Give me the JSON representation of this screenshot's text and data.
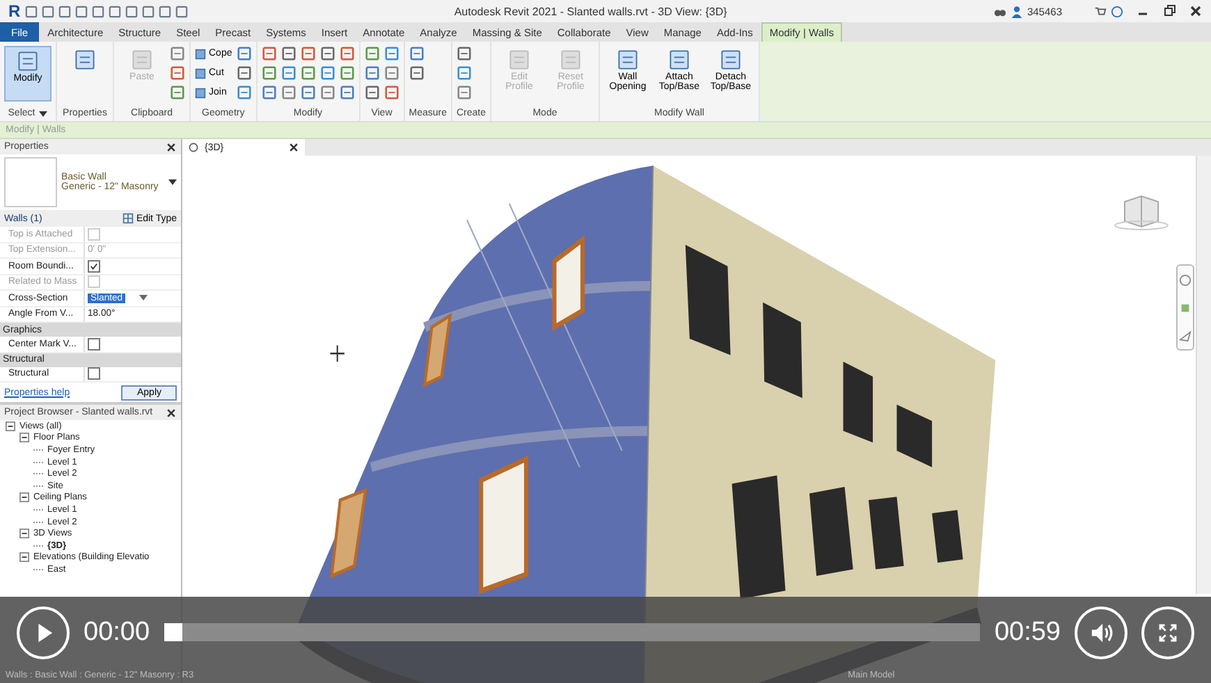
{
  "window": {
    "logo": "R",
    "title": "Autodesk Revit 2021 - Slanted walls.rvt - 3D View: {3D}",
    "user": "345463"
  },
  "ribbon_tabs": [
    {
      "label": "File",
      "kind": "file",
      "selected": false
    },
    {
      "label": "Architecture",
      "kind": "tab",
      "selected": false
    },
    {
      "label": "Structure",
      "kind": "tab",
      "selected": false
    },
    {
      "label": "Steel",
      "kind": "tab",
      "selected": false
    },
    {
      "label": "Precast",
      "kind": "tab",
      "selected": false
    },
    {
      "label": "Systems",
      "kind": "tab",
      "selected": false
    },
    {
      "label": "Insert",
      "kind": "tab",
      "selected": false
    },
    {
      "label": "Annotate",
      "kind": "tab",
      "selected": false
    },
    {
      "label": "Analyze",
      "kind": "tab",
      "selected": false
    },
    {
      "label": "Massing & Site",
      "kind": "tab",
      "selected": false
    },
    {
      "label": "Collaborate",
      "kind": "tab",
      "selected": false
    },
    {
      "label": "View",
      "kind": "tab",
      "selected": false
    },
    {
      "label": "Manage",
      "kind": "tab",
      "selected": false
    },
    {
      "label": "Add-Ins",
      "kind": "tab",
      "selected": false
    },
    {
      "label": "Modify | Walls",
      "kind": "context",
      "selected": true
    }
  ],
  "ribbon_panels": [
    {
      "label": "Select",
      "menu": true,
      "tools": [
        {
          "kind": "large",
          "label": "Modify",
          "disabled": false,
          "selected": true
        }
      ]
    },
    {
      "label": "Properties",
      "menu": false,
      "tools": [
        {
          "kind": "large",
          "disabled": false,
          "selected": false
        }
      ]
    },
    {
      "label": "Clipboard",
      "menu": false,
      "tools": [
        {
          "kind": "large",
          "label": "Paste",
          "disabled": true,
          "selected": false
        },
        {
          "kind": "icon"
        },
        {
          "kind": "icon"
        },
        {
          "kind": "icon"
        }
      ]
    },
    {
      "label": "Geometry",
      "menu": false,
      "tools": [
        {
          "kind": "small",
          "label": "Cope"
        },
        {
          "kind": "small",
          "label": "Cut"
        },
        {
          "kind": "small",
          "label": "Join"
        },
        {
          "kind": "icon"
        },
        {
          "kind": "icon"
        },
        {
          "kind": "icon"
        }
      ]
    },
    {
      "label": "Modify",
      "menu": false,
      "tools": [
        {
          "kind": "icon"
        },
        {
          "kind": "icon"
        },
        {
          "kind": "icon"
        },
        {
          "kind": "icon"
        },
        {
          "kind": "icon"
        },
        {
          "kind": "icon"
        },
        {
          "kind": "icon"
        },
        {
          "kind": "icon"
        },
        {
          "kind": "icon"
        },
        {
          "kind": "icon"
        },
        {
          "kind": "icon"
        },
        {
          "kind": "icon"
        },
        {
          "kind": "icon"
        },
        {
          "kind": "icon"
        },
        {
          "kind": "icon"
        }
      ]
    },
    {
      "label": "View",
      "menu": false,
      "tools": [
        {
          "kind": "icon"
        },
        {
          "kind": "icon"
        },
        {
          "kind": "icon"
        },
        {
          "kind": "icon"
        },
        {
          "kind": "icon"
        },
        {
          "kind": "icon"
        }
      ]
    },
    {
      "label": "Measure",
      "menu": false,
      "tools": [
        {
          "kind": "icon"
        },
        {
          "kind": "icon"
        }
      ]
    },
    {
      "label": "Create",
      "menu": false,
      "tools": [
        {
          "kind": "icon"
        },
        {
          "kind": "icon"
        },
        {
          "kind": "icon"
        }
      ]
    },
    {
      "label": "Mode",
      "menu": false,
      "tools": [
        {
          "kind": "large",
          "label": "Edit Profile",
          "disabled": true,
          "selected": false
        },
        {
          "kind": "large",
          "label": "Reset Profile",
          "disabled": true,
          "selected": false
        }
      ]
    },
    {
      "label": "Modify Wall",
      "menu": false,
      "tools": [
        {
          "kind": "large",
          "label": "Wall Opening",
          "disabled": false,
          "selected": false
        },
        {
          "kind": "large",
          "label": "Attach Top/Base",
          "disabled": false,
          "selected": false
        },
        {
          "kind": "large",
          "label": "Detach Top/Base",
          "disabled": false,
          "selected": false
        }
      ]
    }
  ],
  "context_bar": "Modify | Walls",
  "properties": {
    "title": "Properties",
    "type_family": "Basic Wall",
    "type_name": "Generic - 12\" Masonry",
    "instance_filter": "Walls (1)",
    "edit_type": "Edit Type",
    "rows": [
      {
        "kind": "checkbox",
        "label": "Top is Attached",
        "checked": false,
        "disabled": true
      },
      {
        "kind": "text",
        "label": "Top Extension...",
        "value": "0' 0\"",
        "disabled": true
      },
      {
        "kind": "checkbox",
        "label": "Room Boundi...",
        "checked": true,
        "disabled": false
      },
      {
        "kind": "checkbox",
        "label": "Related to Mass",
        "checked": false,
        "disabled": true
      },
      {
        "kind": "dropdown",
        "label": "Cross-Section",
        "value": "Slanted",
        "disabled": false
      },
      {
        "kind": "text",
        "label": "Angle From V...",
        "value": "18.00°",
        "disabled": false
      },
      {
        "kind": "group",
        "label": "Graphics"
      },
      {
        "kind": "checkbox",
        "label": "Center Mark V...",
        "checked": false,
        "disabled": false
      },
      {
        "kind": "group",
        "label": "Structural"
      },
      {
        "kind": "checkbox",
        "label": "Structural",
        "checked": false,
        "disabled": false
      }
    ],
    "help": "Properties help",
    "apply": "Apply"
  },
  "project_browser": {
    "title": "Project Browser - Slanted walls.rvt",
    "tree": [
      {
        "label": "Views (all)",
        "expanded": true,
        "active": false,
        "children": [
          {
            "label": "Floor Plans",
            "expanded": true,
            "active": false,
            "children": [
              {
                "label": "Foyer Entry",
                "active": false
              },
              {
                "label": "Level 1",
                "active": false
              },
              {
                "label": "Level 2",
                "active": false
              },
              {
                "label": "Site",
                "active": false
              }
            ]
          },
          {
            "label": "Ceiling Plans",
            "expanded": true,
            "active": false,
            "children": [
              {
                "label": "Level 1",
                "active": false
              },
              {
                "label": "Level 2",
                "active": false
              }
            ]
          },
          {
            "label": "3D Views",
            "expanded": true,
            "active": false,
            "children": [
              {
                "label": "{3D}",
                "active": true
              }
            ]
          },
          {
            "label": "Elevations (Building Elevatio",
            "expanded": true,
            "active": false,
            "children": [
              {
                "label": "East",
                "active": false
              }
            ]
          }
        ]
      }
    ]
  },
  "view_tab": {
    "label": "{3D}"
  },
  "player": {
    "current_time": "00:00",
    "duration": "00:59",
    "level": 0
  },
  "status_bar": {
    "text": "Walls : Basic Wall : Generic - 12\" Masonry : R3",
    "model": "Main Model"
  }
}
